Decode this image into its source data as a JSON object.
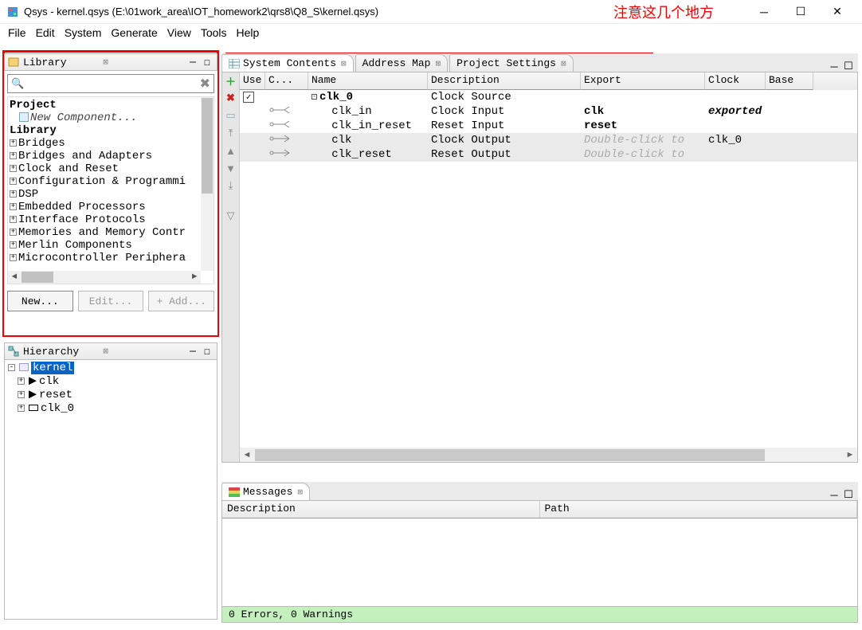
{
  "window": {
    "title": "Qsys - kernel.qsys (E:\\01work_area\\IOT_homework2\\qrs8\\Q8_S\\kernel.qsys)",
    "annotation": "注意这几个地方"
  },
  "menubar": [
    "File",
    "Edit",
    "System",
    "Generate",
    "View",
    "Tools",
    "Help"
  ],
  "library": {
    "title": "Library",
    "search_placeholder": "",
    "project_label": "Project",
    "new_component": "New Component...",
    "library_label": "Library",
    "categories": [
      "Bridges",
      "Bridges and Adapters",
      "Clock and Reset",
      "Configuration & Programmi",
      "DSP",
      "Embedded Processors",
      "Interface Protocols",
      "Memories and Memory Contr",
      "Merlin Components",
      "Microcontroller Periphera"
    ],
    "buttons": {
      "new": "New...",
      "edit": "Edit...",
      "add": "+ Add..."
    }
  },
  "hierarchy": {
    "title": "Hierarchy",
    "root": "kernel",
    "items": [
      "clk",
      "reset",
      "clk_0"
    ]
  },
  "systemContents": {
    "tabs": [
      {
        "label": "System Contents",
        "active": true
      },
      {
        "label": "Address Map",
        "active": false
      },
      {
        "label": "Project Settings",
        "active": false
      }
    ],
    "columns": {
      "use": "Use",
      "conn": "C...",
      "name": "Name",
      "desc": "Description",
      "export": "Export",
      "clock": "Clock",
      "base": "Base"
    },
    "rows": [
      {
        "indent": 0,
        "name": "clk_0",
        "bold": true,
        "desc": "Clock Source",
        "export": "",
        "clock": "",
        "checked": true,
        "box": "-"
      },
      {
        "indent": 1,
        "name": "clk_in",
        "desc": "Clock Input",
        "export": "clk",
        "exp_bold": true,
        "clock": "exported",
        "clk_italic": true
      },
      {
        "indent": 1,
        "name": "clk_in_reset",
        "desc": "Reset Input",
        "export": "reset",
        "exp_bold": true,
        "clock": ""
      },
      {
        "indent": 1,
        "name": "clk",
        "desc": "Clock Output",
        "export": "Double-click to",
        "exp_ghost": true,
        "clock": "clk_0"
      },
      {
        "indent": 1,
        "name": "clk_reset",
        "desc": "Reset Output",
        "export": "Double-click to",
        "exp_ghost": true,
        "clock": ""
      }
    ]
  },
  "messages": {
    "title": "Messages",
    "cols": {
      "desc": "Description",
      "path": "Path"
    },
    "footer": "0 Errors, 0 Warnings"
  }
}
